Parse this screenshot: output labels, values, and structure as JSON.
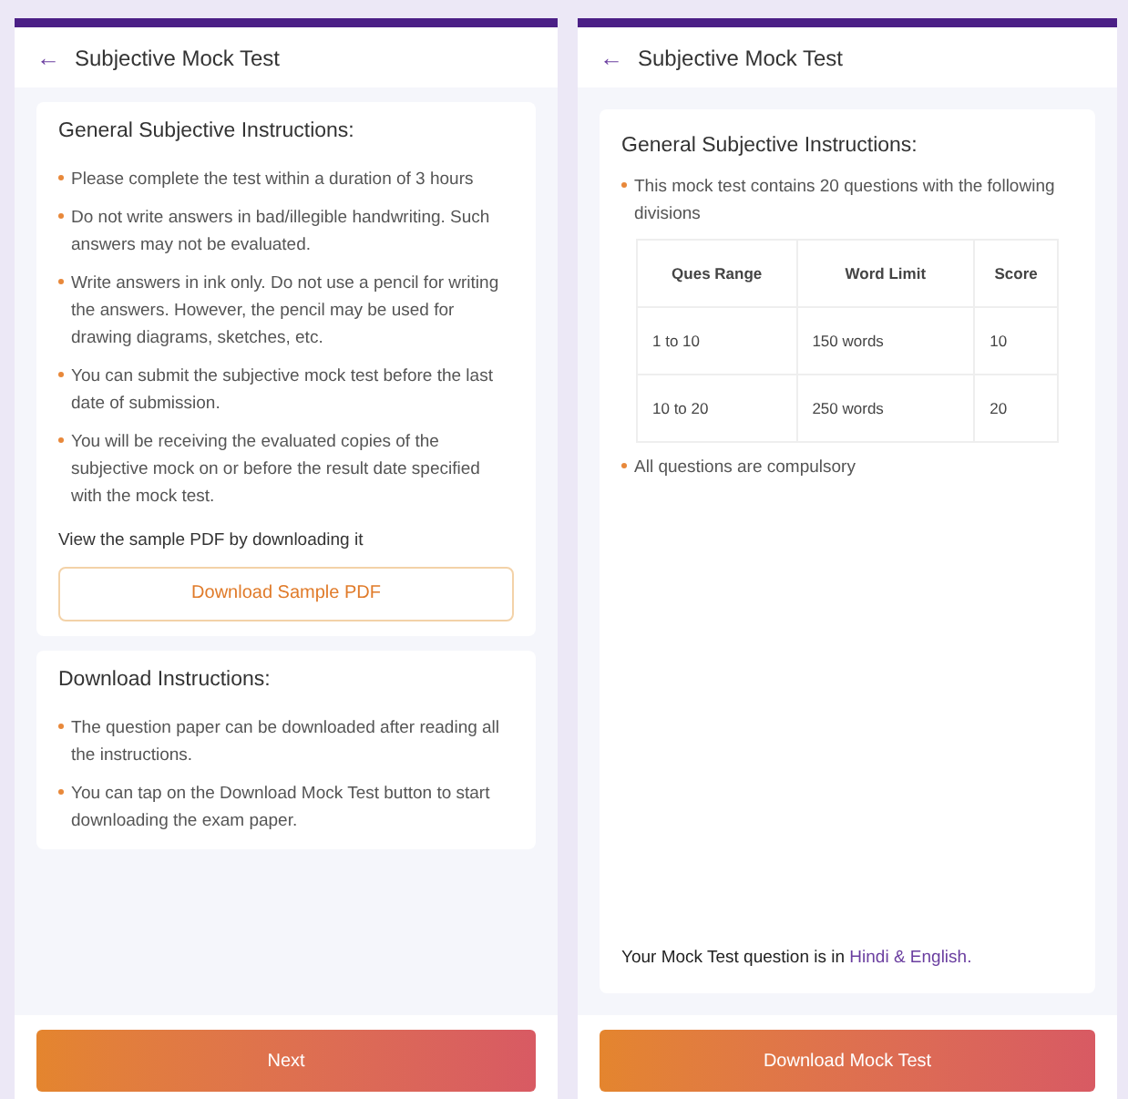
{
  "left_screen": {
    "header": {
      "back_icon": "←",
      "title": "Subjective Mock Test"
    },
    "general_card": {
      "heading": "General Subjective Instructions:",
      "items": [
        "Please complete the test within a duration of 3 hours",
        "Do not write answers in bad/illegible handwriting. Such answers may not be evaluated.",
        "Write answers in ink only. Do not use a pencil for writing the answers. However, the pencil may be used for drawing diagrams, sketches, etc.",
        "You can submit the subjective mock test before the last date of submission.",
        "You will be receiving the evaluated copies of the subjective mock on or before the result date specified with the mock test."
      ],
      "sample_label": "View the sample PDF by downloading it",
      "sample_button": "Download Sample PDF"
    },
    "download_card": {
      "heading": "Download Instructions:",
      "items": [
        "The question paper can be downloaded after reading all the instructions.",
        "You can tap on the Download Mock Test button to start downloading the exam paper."
      ]
    },
    "primary_button": "Next"
  },
  "right_screen": {
    "header": {
      "back_icon": "←",
      "title": "Subjective Mock Test"
    },
    "card": {
      "heading": "General Subjective Instructions:",
      "intro": "This mock test contains 20 questions with the following divisions",
      "table": {
        "columns": [
          "Ques Range",
          "Word Limit",
          "Score"
        ],
        "rows": [
          [
            "1 to 10",
            "150 words",
            "10"
          ],
          [
            "10 to 20",
            "250 words",
            "20"
          ]
        ]
      },
      "footer_item": "All questions are compulsory",
      "language_note": "Your Mock Test question is in",
      "language_highlight": "Hindi & English."
    },
    "primary_button": "Download Mock Test"
  }
}
